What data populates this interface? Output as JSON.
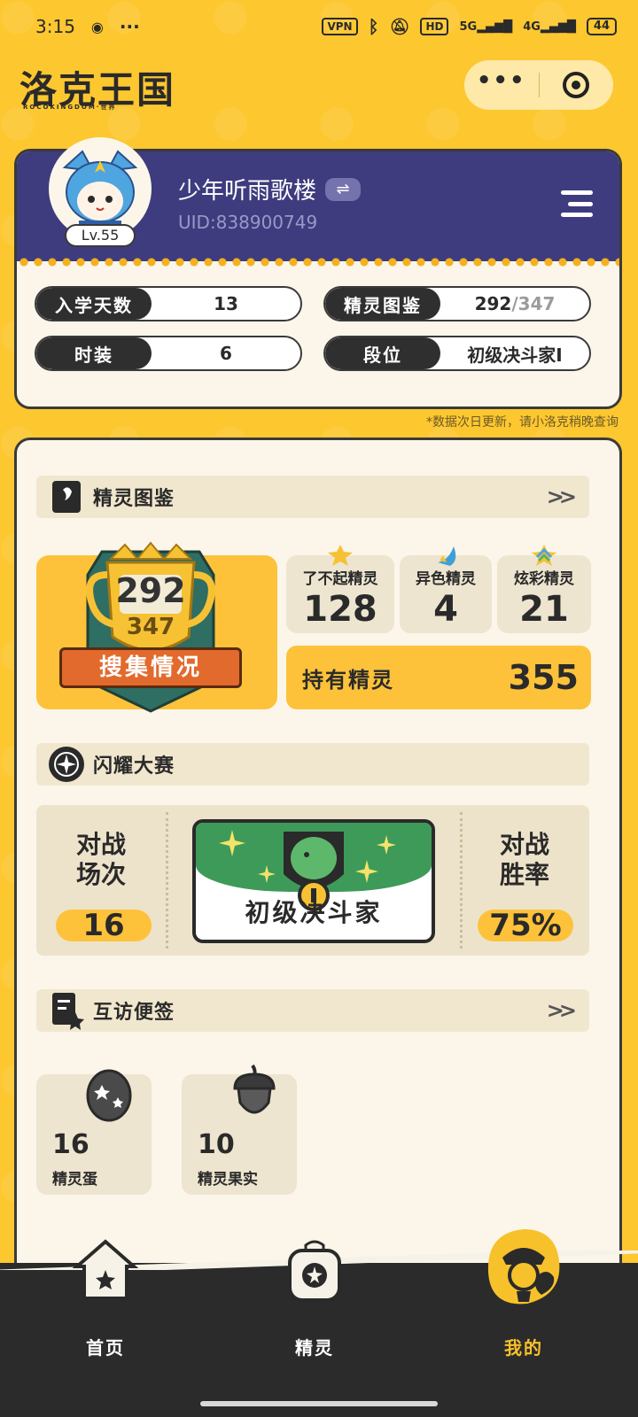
{
  "status_bar": {
    "time": "3:15",
    "vpn": "VPN",
    "hd": "HD",
    "net1": "5G",
    "net2": "4G",
    "battery": "44"
  },
  "header": {
    "logo": "洛克王国",
    "logo_sub": "ROCOKINGDOM·世界",
    "more_icon": "ellipsis-icon",
    "close_icon": "target-icon"
  },
  "profile": {
    "nickname": "少年听雨歌楼",
    "swap_icon": "⇌",
    "uid": "UID:838900749",
    "level": "Lv.55",
    "stats": [
      {
        "label": "入学天数",
        "value": "13"
      },
      {
        "label": "精灵图鉴",
        "value_main": "292",
        "value_sub": "/347"
      },
      {
        "label": "时装",
        "value": "6"
      },
      {
        "label": "段位",
        "value": "初级决斗家I"
      }
    ],
    "note": "*数据次日更新，请小洛克稍晚查询"
  },
  "pokedex": {
    "title": "精灵图鉴",
    "more": ">>",
    "collected": "292",
    "total": "347",
    "ribbon": "搜集情况",
    "cards": [
      {
        "label": "了不起精灵",
        "value": "128"
      },
      {
        "label": "异色精灵",
        "value": "4"
      },
      {
        "label": "炫彩精灵",
        "value": "21"
      }
    ],
    "owned_label": "持有精灵",
    "owned_value": "355"
  },
  "contest": {
    "title": "闪耀大赛",
    "left_title_1": "对战",
    "left_title_2": "场次",
    "left_value": "16",
    "rank": "初级决斗家",
    "rank_badge": "I",
    "right_title_1": "对战",
    "right_title_2": "胜率",
    "right_value": "75%"
  },
  "visits": {
    "title": "互访便签",
    "more": ">>",
    "items": [
      {
        "value": "16",
        "label": "精灵蛋"
      },
      {
        "value": "10",
        "label": "精灵果实"
      }
    ]
  },
  "nav": {
    "items": [
      {
        "label": "首页"
      },
      {
        "label": "精灵"
      },
      {
        "label": "我的"
      }
    ],
    "active_color": "#F7C12B"
  }
}
